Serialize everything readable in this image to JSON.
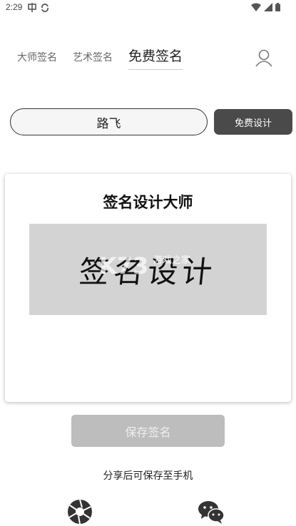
{
  "status_bar": {
    "time": "2:29"
  },
  "tabs": [
    {
      "label": "大师签名",
      "active": false
    },
    {
      "label": "艺术签名",
      "active": false
    },
    {
      "label": "免费签名",
      "active": true
    }
  ],
  "input": {
    "value": "路飞"
  },
  "design_button": {
    "label": "免费设计"
  },
  "card": {
    "title": "签名设计大师",
    "signature_text": "签名设计",
    "watermark_text": "游戏之家"
  },
  "save_button": {
    "label": "保存签名"
  },
  "share_hint": "分享后可保存至手机",
  "icons": {
    "profile": "user-icon",
    "moments": "wechat-moments-icon",
    "wechat": "wechat-icon"
  },
  "colors": {
    "design_button_bg": "#4a4a4a",
    "save_button_bg": "#bdbdbd",
    "preview_bg": "#d3d3d3"
  }
}
